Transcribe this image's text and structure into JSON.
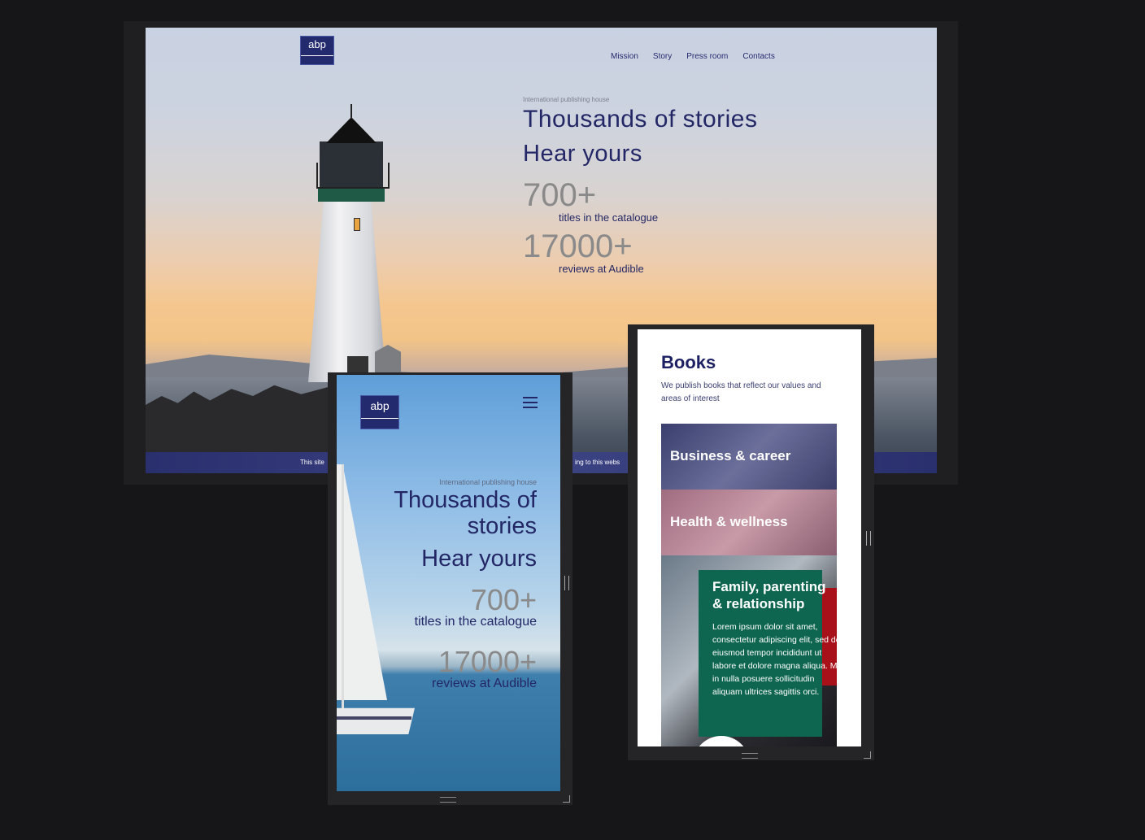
{
  "desktop": {
    "logo": "abp",
    "nav": [
      "Mission",
      "Story",
      "Press room",
      "Contacts"
    ],
    "tagline": "International publishing house",
    "headline": "Thousands of stories",
    "subheadline": "Hear yours",
    "stat1_value": "700+",
    "stat1_label": "titles in the catalogue",
    "stat2_value": "17000+",
    "stat2_label": "reviews at Audible",
    "cookie_left": "This site",
    "cookie_right": "ing to this webs"
  },
  "mobile": {
    "logo": "abp",
    "menu_icon": "hamburger-icon",
    "tagline": "International publishing house",
    "headline": "Thousands of stories",
    "subheadline": "Hear yours",
    "stat1_value": "700+",
    "stat1_label": "titles in the catalogue",
    "stat2_value": "17000+",
    "stat2_label": "reviews at Audible"
  },
  "tablet": {
    "title": "Books",
    "description": "We publish books that reflect our values and areas of interest",
    "categories": [
      {
        "label": "Business & career"
      },
      {
        "label": "Health & wellness"
      },
      {
        "label": "Family, parenting & relationship",
        "text": "Lorem ipsum dolor sit amet, consectetur adipiscing elit, sed do eiusmod tempor incididunt ut labore et dolore magna aliqua. Mi in nulla posuere sollicitudin aliquam ultrices sagittis orci."
      }
    ]
  },
  "colors": {
    "brand_navy": "#232766",
    "accent_green": "#0e6650",
    "stat_gray": "#8a8a8a"
  }
}
